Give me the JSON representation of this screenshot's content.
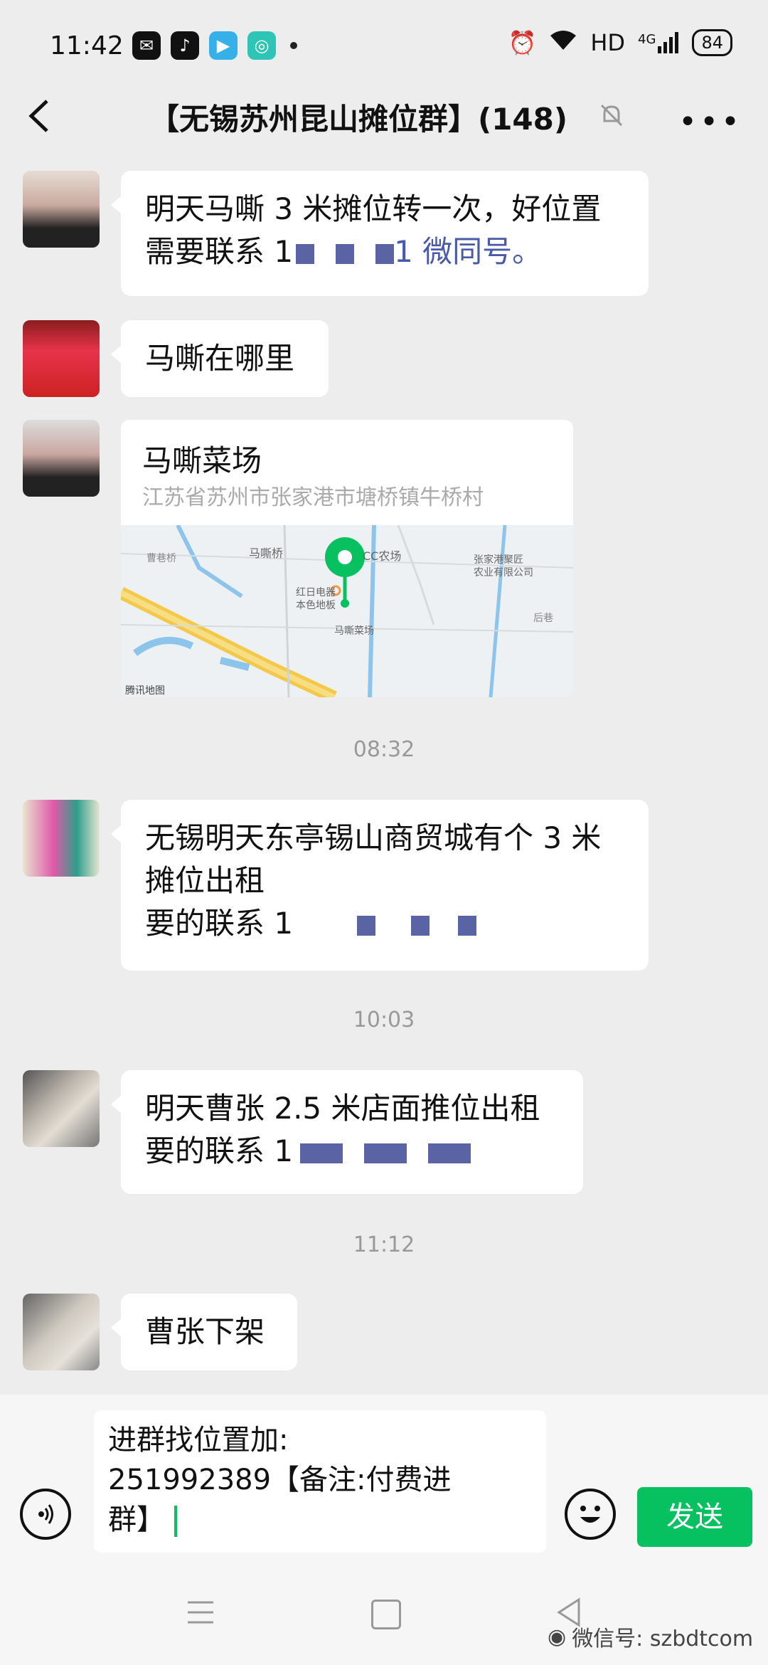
{
  "status_bar": {
    "time": "11:42",
    "network": "HD",
    "signal_label": "4G",
    "battery": "84"
  },
  "header": {
    "title": "【无锡苏州昆山摊位群】(148)"
  },
  "messages": [
    {
      "line1": "明天马嘶 3 米摊位转一次，好位置",
      "line2_prefix": "需要联系 1",
      "line2_suffix": "1 微同号。"
    },
    {
      "text": "马嘶在哪里"
    },
    {
      "loc_name": "马嘶菜场",
      "loc_address": "江苏省苏州市张家港市塘桥镇牛桥村",
      "map_labels": [
        "马嘶桥",
        "CC农场",
        "张家港聚匠",
        "农业有限公司",
        "红日电器",
        "本色地板",
        "马嘶菜场",
        "曹巷桥",
        "后巷",
        "腾讯地图"
      ]
    },
    {
      "line1": "无锡明天东亭锡山商贸城有个 3 米",
      "line2": "摊位出租",
      "line3_prefix": "要的联系 1"
    },
    {
      "line1": "明天曹张 2.5 米店面推位出租",
      "line2_prefix": "要的联系 1"
    },
    {
      "text": "曹张下架"
    }
  ],
  "timestamps": [
    "08:32",
    "10:03",
    "11:12"
  ],
  "input": {
    "line1": "进群找位置加:",
    "line2": "251992389【备注:付费进",
    "line3": "群】"
  },
  "send_label": "发送",
  "watermark": "微信号: szbdtcom",
  "colors": {
    "accent": "#07c160",
    "background": "#ededed"
  }
}
